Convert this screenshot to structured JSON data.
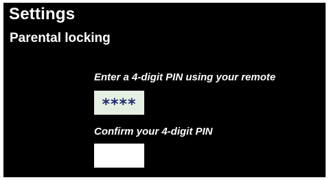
{
  "header": {
    "title": "Settings",
    "subtitle": "Parental locking"
  },
  "pin_entry": {
    "prompt": "Enter a 4-digit PIN using your remote",
    "value": "****"
  },
  "pin_confirm": {
    "prompt": "Confirm your 4-digit PIN",
    "value": ""
  },
  "colors": {
    "screen_background": "#000000",
    "text": "#ffffff",
    "active_field_background": "#e5efe2",
    "field_background": "#ffffff",
    "pin_mask_color": "#1d2a73"
  }
}
